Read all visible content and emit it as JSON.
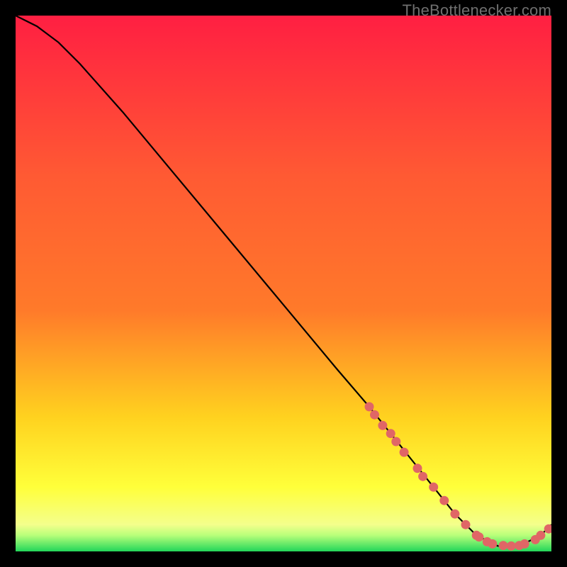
{
  "watermark": "TheBottlenecker.com",
  "colors": {
    "bg_black": "#000000",
    "grad_top": "#ff1f42",
    "grad_mid1": "#ff7a2a",
    "grad_mid2": "#ffd21f",
    "grad_mid3": "#ffff3a",
    "grad_low": "#f4ff8c",
    "grad_green": "#22d65a",
    "line": "#000000",
    "marker_fill": "#e06666",
    "marker_stroke": "#ca5555"
  },
  "chart_data": {
    "type": "line",
    "title": "",
    "xlabel": "",
    "ylabel": "",
    "xlim": [
      0,
      100
    ],
    "ylim": [
      0,
      100
    ],
    "series": [
      {
        "name": "bottleneck-curve",
        "x": [
          0,
          4,
          8,
          12,
          20,
          30,
          40,
          50,
          60,
          66,
          70,
          74,
          78,
          82,
          86,
          90,
          94,
          98,
          100
        ],
        "y": [
          100,
          98,
          95,
          91,
          82,
          70,
          58,
          46,
          34,
          27,
          22,
          17,
          12,
          7,
          3,
          1,
          1,
          3,
          5
        ]
      }
    ],
    "markers": {
      "name": "sample-points",
      "x": [
        66,
        67,
        68.5,
        70,
        71,
        72.5,
        75,
        76,
        78,
        80,
        82,
        84,
        86,
        86.5,
        88,
        89,
        91,
        92.5,
        94,
        95,
        97,
        98,
        99.5
      ],
      "y": [
        27,
        25.5,
        23.5,
        22,
        20.5,
        18.5,
        15.5,
        14,
        12,
        9.5,
        7,
        5,
        3,
        2.7,
        1.8,
        1.4,
        1.1,
        1.0,
        1.1,
        1.4,
        2.2,
        3.0,
        4.2
      ]
    }
  }
}
